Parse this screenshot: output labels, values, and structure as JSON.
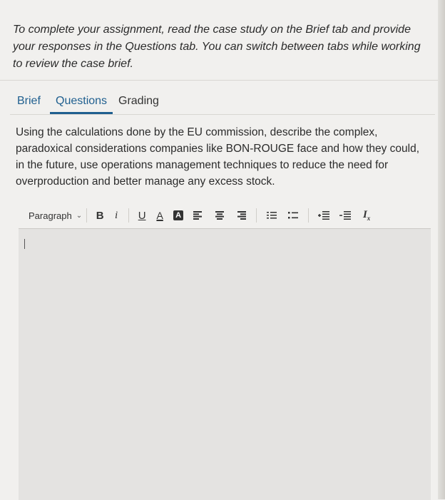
{
  "instructions": "To complete your assignment, read the case study on the Brief tab and provide your responses in the Questions tab. You can switch between tabs while working to review the case brief.",
  "tabs": {
    "brief": "Brief",
    "questions": "Questions",
    "grading": "Grading",
    "active": "Questions"
  },
  "question": "Using the calculations done by the EU commission, describe the complex, paradoxical considerations companies like BON-ROUGE face and how they could, in the future, use operations management techniques to reduce the need for overproduction and better manage any excess stock.",
  "toolbar": {
    "paragraph_label": "Paragraph",
    "bold": "B",
    "italic": "i",
    "underline": "U",
    "text_color": "A",
    "highlight": "A",
    "clear_formatting": "I",
    "clear_sub": "x"
  },
  "editor": {
    "value": ""
  },
  "colors": {
    "accent": "#1f5f8f",
    "background": "#f1f0ee",
    "editor_bg": "#e4e3e1"
  }
}
